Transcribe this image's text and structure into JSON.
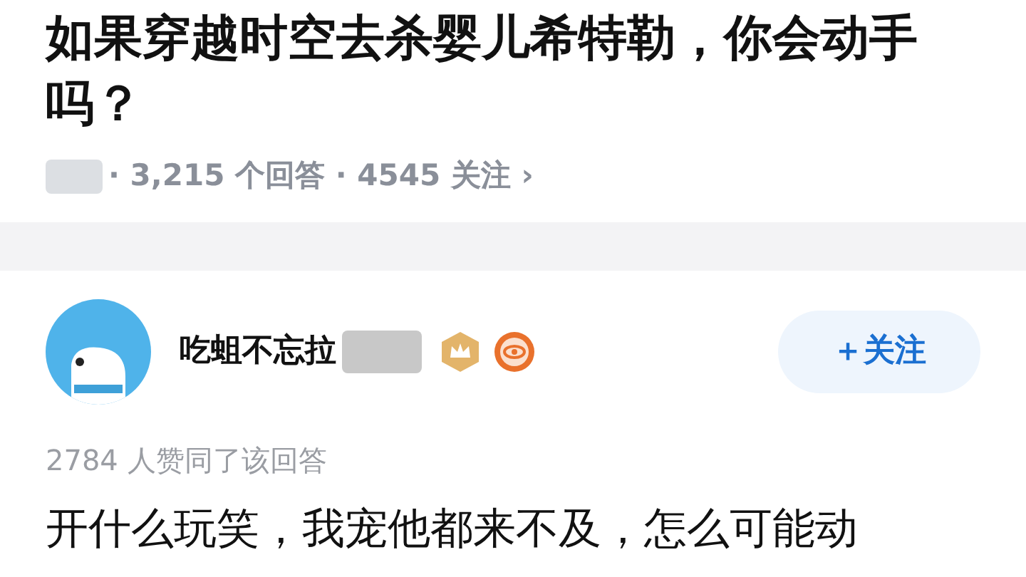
{
  "question": {
    "title": "如果穿越时空去杀婴儿希特勒，你会动手吗？",
    "meta": "· 3,215 个回答 · 4545 关注 ›"
  },
  "answer": {
    "author": "吃蛆不忘拉",
    "follow_button": "＋关注",
    "likes": "2784 人赞同了该回答",
    "body": "开什么玩笑，我宠他都来不及，怎么可能动"
  }
}
